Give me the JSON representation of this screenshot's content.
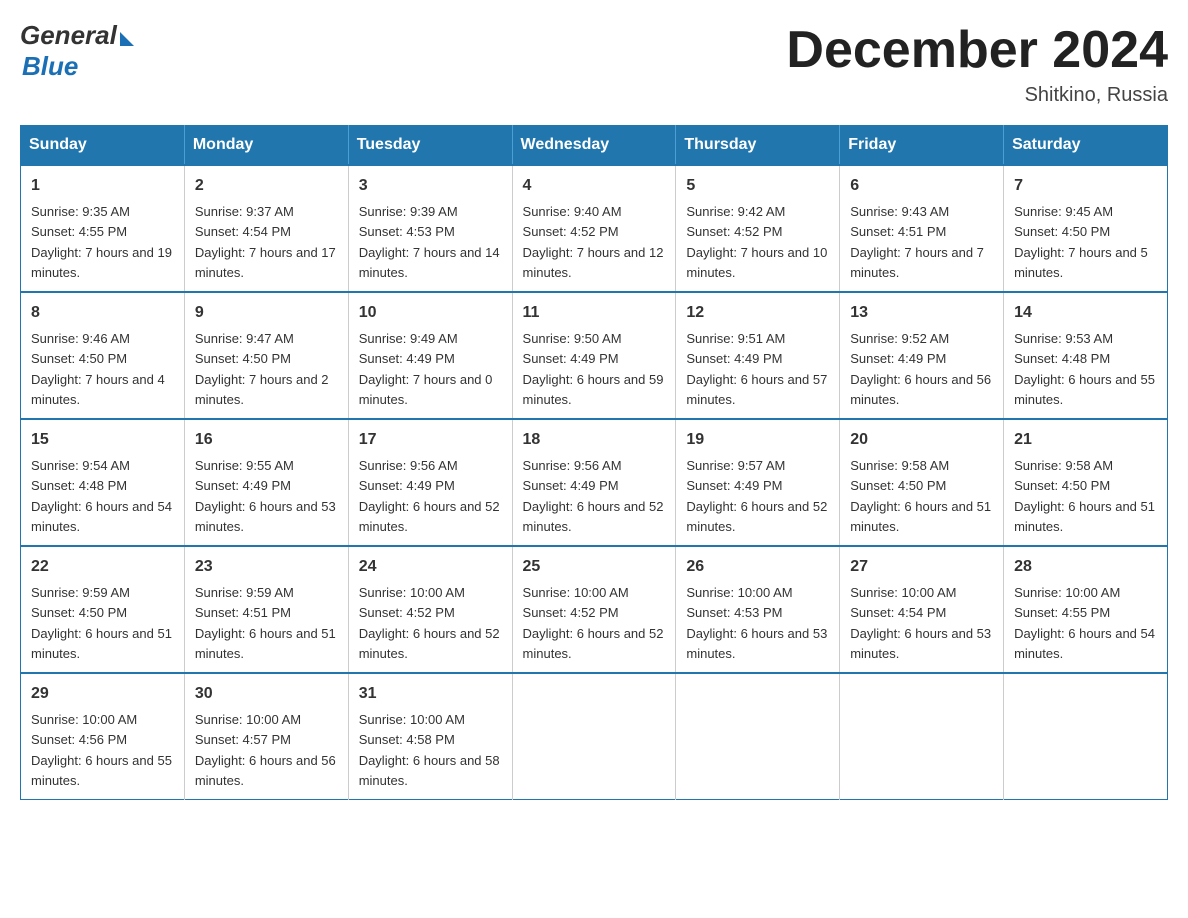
{
  "header": {
    "logo": {
      "general": "General",
      "blue": "Blue"
    },
    "title": "December 2024",
    "location": "Shitkino, Russia"
  },
  "calendar": {
    "days_of_week": [
      "Sunday",
      "Monday",
      "Tuesday",
      "Wednesday",
      "Thursday",
      "Friday",
      "Saturday"
    ],
    "weeks": [
      [
        {
          "day": "1",
          "sunrise": "Sunrise: 9:35 AM",
          "sunset": "Sunset: 4:55 PM",
          "daylight": "Daylight: 7 hours and 19 minutes."
        },
        {
          "day": "2",
          "sunrise": "Sunrise: 9:37 AM",
          "sunset": "Sunset: 4:54 PM",
          "daylight": "Daylight: 7 hours and 17 minutes."
        },
        {
          "day": "3",
          "sunrise": "Sunrise: 9:39 AM",
          "sunset": "Sunset: 4:53 PM",
          "daylight": "Daylight: 7 hours and 14 minutes."
        },
        {
          "day": "4",
          "sunrise": "Sunrise: 9:40 AM",
          "sunset": "Sunset: 4:52 PM",
          "daylight": "Daylight: 7 hours and 12 minutes."
        },
        {
          "day": "5",
          "sunrise": "Sunrise: 9:42 AM",
          "sunset": "Sunset: 4:52 PM",
          "daylight": "Daylight: 7 hours and 10 minutes."
        },
        {
          "day": "6",
          "sunrise": "Sunrise: 9:43 AM",
          "sunset": "Sunset: 4:51 PM",
          "daylight": "Daylight: 7 hours and 7 minutes."
        },
        {
          "day": "7",
          "sunrise": "Sunrise: 9:45 AM",
          "sunset": "Sunset: 4:50 PM",
          "daylight": "Daylight: 7 hours and 5 minutes."
        }
      ],
      [
        {
          "day": "8",
          "sunrise": "Sunrise: 9:46 AM",
          "sunset": "Sunset: 4:50 PM",
          "daylight": "Daylight: 7 hours and 4 minutes."
        },
        {
          "day": "9",
          "sunrise": "Sunrise: 9:47 AM",
          "sunset": "Sunset: 4:50 PM",
          "daylight": "Daylight: 7 hours and 2 minutes."
        },
        {
          "day": "10",
          "sunrise": "Sunrise: 9:49 AM",
          "sunset": "Sunset: 4:49 PM",
          "daylight": "Daylight: 7 hours and 0 minutes."
        },
        {
          "day": "11",
          "sunrise": "Sunrise: 9:50 AM",
          "sunset": "Sunset: 4:49 PM",
          "daylight": "Daylight: 6 hours and 59 minutes."
        },
        {
          "day": "12",
          "sunrise": "Sunrise: 9:51 AM",
          "sunset": "Sunset: 4:49 PM",
          "daylight": "Daylight: 6 hours and 57 minutes."
        },
        {
          "day": "13",
          "sunrise": "Sunrise: 9:52 AM",
          "sunset": "Sunset: 4:49 PM",
          "daylight": "Daylight: 6 hours and 56 minutes."
        },
        {
          "day": "14",
          "sunrise": "Sunrise: 9:53 AM",
          "sunset": "Sunset: 4:48 PM",
          "daylight": "Daylight: 6 hours and 55 minutes."
        }
      ],
      [
        {
          "day": "15",
          "sunrise": "Sunrise: 9:54 AM",
          "sunset": "Sunset: 4:48 PM",
          "daylight": "Daylight: 6 hours and 54 minutes."
        },
        {
          "day": "16",
          "sunrise": "Sunrise: 9:55 AM",
          "sunset": "Sunset: 4:49 PM",
          "daylight": "Daylight: 6 hours and 53 minutes."
        },
        {
          "day": "17",
          "sunrise": "Sunrise: 9:56 AM",
          "sunset": "Sunset: 4:49 PM",
          "daylight": "Daylight: 6 hours and 52 minutes."
        },
        {
          "day": "18",
          "sunrise": "Sunrise: 9:56 AM",
          "sunset": "Sunset: 4:49 PM",
          "daylight": "Daylight: 6 hours and 52 minutes."
        },
        {
          "day": "19",
          "sunrise": "Sunrise: 9:57 AM",
          "sunset": "Sunset: 4:49 PM",
          "daylight": "Daylight: 6 hours and 52 minutes."
        },
        {
          "day": "20",
          "sunrise": "Sunrise: 9:58 AM",
          "sunset": "Sunset: 4:50 PM",
          "daylight": "Daylight: 6 hours and 51 minutes."
        },
        {
          "day": "21",
          "sunrise": "Sunrise: 9:58 AM",
          "sunset": "Sunset: 4:50 PM",
          "daylight": "Daylight: 6 hours and 51 minutes."
        }
      ],
      [
        {
          "day": "22",
          "sunrise": "Sunrise: 9:59 AM",
          "sunset": "Sunset: 4:50 PM",
          "daylight": "Daylight: 6 hours and 51 minutes."
        },
        {
          "day": "23",
          "sunrise": "Sunrise: 9:59 AM",
          "sunset": "Sunset: 4:51 PM",
          "daylight": "Daylight: 6 hours and 51 minutes."
        },
        {
          "day": "24",
          "sunrise": "Sunrise: 10:00 AM",
          "sunset": "Sunset: 4:52 PM",
          "daylight": "Daylight: 6 hours and 52 minutes."
        },
        {
          "day": "25",
          "sunrise": "Sunrise: 10:00 AM",
          "sunset": "Sunset: 4:52 PM",
          "daylight": "Daylight: 6 hours and 52 minutes."
        },
        {
          "day": "26",
          "sunrise": "Sunrise: 10:00 AM",
          "sunset": "Sunset: 4:53 PM",
          "daylight": "Daylight: 6 hours and 53 minutes."
        },
        {
          "day": "27",
          "sunrise": "Sunrise: 10:00 AM",
          "sunset": "Sunset: 4:54 PM",
          "daylight": "Daylight: 6 hours and 53 minutes."
        },
        {
          "day": "28",
          "sunrise": "Sunrise: 10:00 AM",
          "sunset": "Sunset: 4:55 PM",
          "daylight": "Daylight: 6 hours and 54 minutes."
        }
      ],
      [
        {
          "day": "29",
          "sunrise": "Sunrise: 10:00 AM",
          "sunset": "Sunset: 4:56 PM",
          "daylight": "Daylight: 6 hours and 55 minutes."
        },
        {
          "day": "30",
          "sunrise": "Sunrise: 10:00 AM",
          "sunset": "Sunset: 4:57 PM",
          "daylight": "Daylight: 6 hours and 56 minutes."
        },
        {
          "day": "31",
          "sunrise": "Sunrise: 10:00 AM",
          "sunset": "Sunset: 4:58 PM",
          "daylight": "Daylight: 6 hours and 58 minutes."
        },
        null,
        null,
        null,
        null
      ]
    ]
  }
}
